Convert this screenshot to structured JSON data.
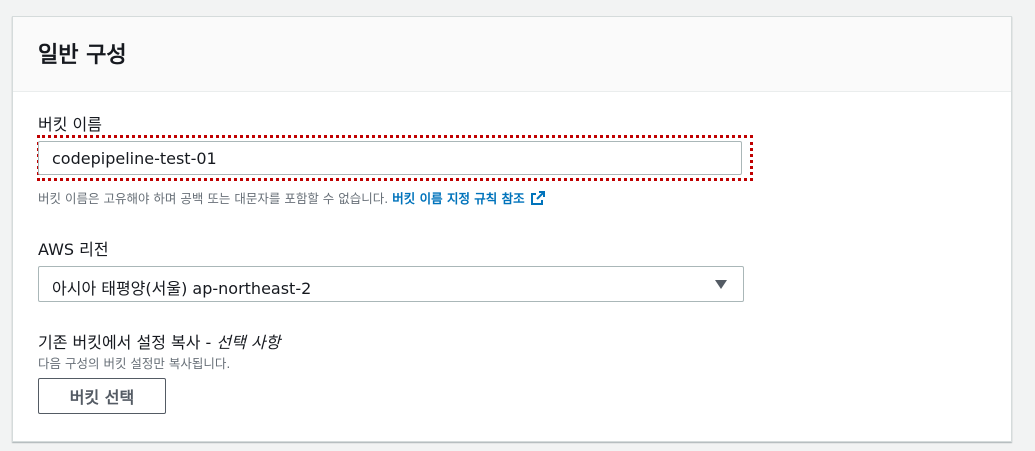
{
  "panel": {
    "title": "일반 구성"
  },
  "bucket_name": {
    "label": "버킷 이름",
    "value": "codepipeline-test-01",
    "hint": "버킷 이름은 고유해야 하며 공백 또는 대문자를 포함할 수 없습니다.",
    "hint_link": "버킷 이름 지정 규칙 참조",
    "link_icon": "external-link-icon"
  },
  "region": {
    "label": "AWS 리전",
    "selected": "아시아 태평양(서울) ap-northeast-2",
    "icon": "caret-down-icon"
  },
  "copy_settings": {
    "label": "기존 버킷에서 설정 복사 - ",
    "optional": "선택 사항",
    "description": "다음 구성의 버킷 설정만 복사됩니다.",
    "button_label": "버킷 선택"
  },
  "colors": {
    "link": "#0073bb",
    "highlight": "#c00000",
    "hint_text": "#687078"
  }
}
